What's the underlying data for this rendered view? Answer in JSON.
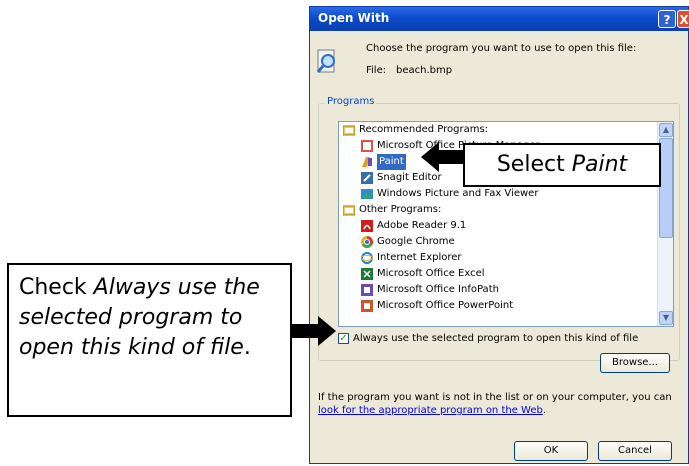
{
  "dialog": {
    "title": "Open With",
    "help_label": "?",
    "close_label": "X",
    "instruction": "Choose the program you want to use to open this file:",
    "file_label": "File:",
    "file_name": "beach.bmp",
    "programs_group_label": "Programs",
    "recommended_header": "Recommended Programs:",
    "other_header": "Other Programs:",
    "recommended": [
      {
        "label": "Microsoft Office Picture Manager",
        "icon": "picture-manager-icon",
        "color": "#d9534f"
      },
      {
        "label": "Paint",
        "icon": "paint-icon",
        "color": "#e0a020",
        "selected": true
      },
      {
        "label": "Snagit Editor",
        "icon": "snagit-icon",
        "color": "#3a6ea5"
      },
      {
        "label": "Windows Picture and Fax Viewer",
        "icon": "picture-viewer-icon",
        "color": "#2d8bd0"
      }
    ],
    "other": [
      {
        "label": "Adobe Reader 9.1",
        "icon": "adobe-reader-icon",
        "color": "#cc1f1f"
      },
      {
        "label": "Google Chrome",
        "icon": "chrome-icon",
        "color": "#e8b020"
      },
      {
        "label": "Internet Explorer",
        "icon": "ie-icon",
        "color": "#1f7fd6"
      },
      {
        "label": "Microsoft Office Excel",
        "icon": "excel-icon",
        "color": "#1f7a3a"
      },
      {
        "label": "Microsoft Office InfoPath",
        "icon": "infopath-icon",
        "color": "#6a4bb8"
      },
      {
        "label": "Microsoft Office PowerPoint",
        "icon": "powerpoint-icon",
        "color": "#d2552a"
      }
    ],
    "always_use_label": "Always use the selected program to open this kind of file",
    "always_use_checked": true,
    "browse_label": "Browse...",
    "footer_text": "If the program you want is not in the list or on your computer, you can ",
    "footer_link": "look for the appropriate program on the Web",
    "footer_end": ".",
    "ok_label": "OK",
    "cancel_label": "Cancel"
  },
  "annotations": {
    "select_prefix": "Select ",
    "select_em": "Paint",
    "check_prefix": "Check ",
    "check_em": "Always use the selected program to open this kind of file",
    "check_end": "."
  },
  "colors": {
    "title_bar": "#0a48c8",
    "selection": "#316ac5",
    "link": "#0000ee"
  }
}
